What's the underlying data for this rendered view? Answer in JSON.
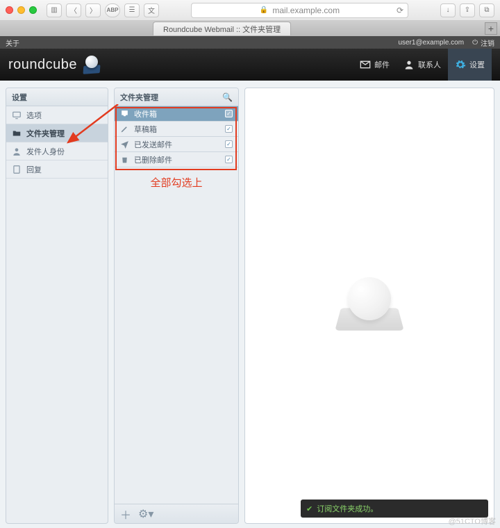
{
  "browser": {
    "url_host": "mail.example.com",
    "tab_title": "Roundcube Webmail :: 文件夹管理"
  },
  "topbar": {
    "about": "关于",
    "user_email": "user1@example.com",
    "logout": "注销"
  },
  "brand": "roundcube",
  "taskbar": {
    "mail": "邮件",
    "contacts": "联系人",
    "settings": "设置"
  },
  "left_panel": {
    "title": "设置",
    "sections": [
      {
        "id": "prefs",
        "label": "选项"
      },
      {
        "id": "folders",
        "label": "文件夹管理",
        "selected": true
      },
      {
        "id": "identities",
        "label": "发件人身份"
      },
      {
        "id": "responses",
        "label": "回复"
      }
    ]
  },
  "mid_panel": {
    "title": "文件夹管理",
    "folders": [
      {
        "id": "inbox",
        "label": "收件箱",
        "checked": true,
        "selected": true
      },
      {
        "id": "drafts",
        "label": "草稿箱",
        "checked": true
      },
      {
        "id": "sent",
        "label": "已发送邮件",
        "checked": true
      },
      {
        "id": "trash",
        "label": "已删除邮件",
        "checked": true
      }
    ],
    "annotation": "全部勾选上"
  },
  "toast": {
    "message": "订阅文件夹成功。"
  },
  "corner_watermark": "@51CTO博客"
}
